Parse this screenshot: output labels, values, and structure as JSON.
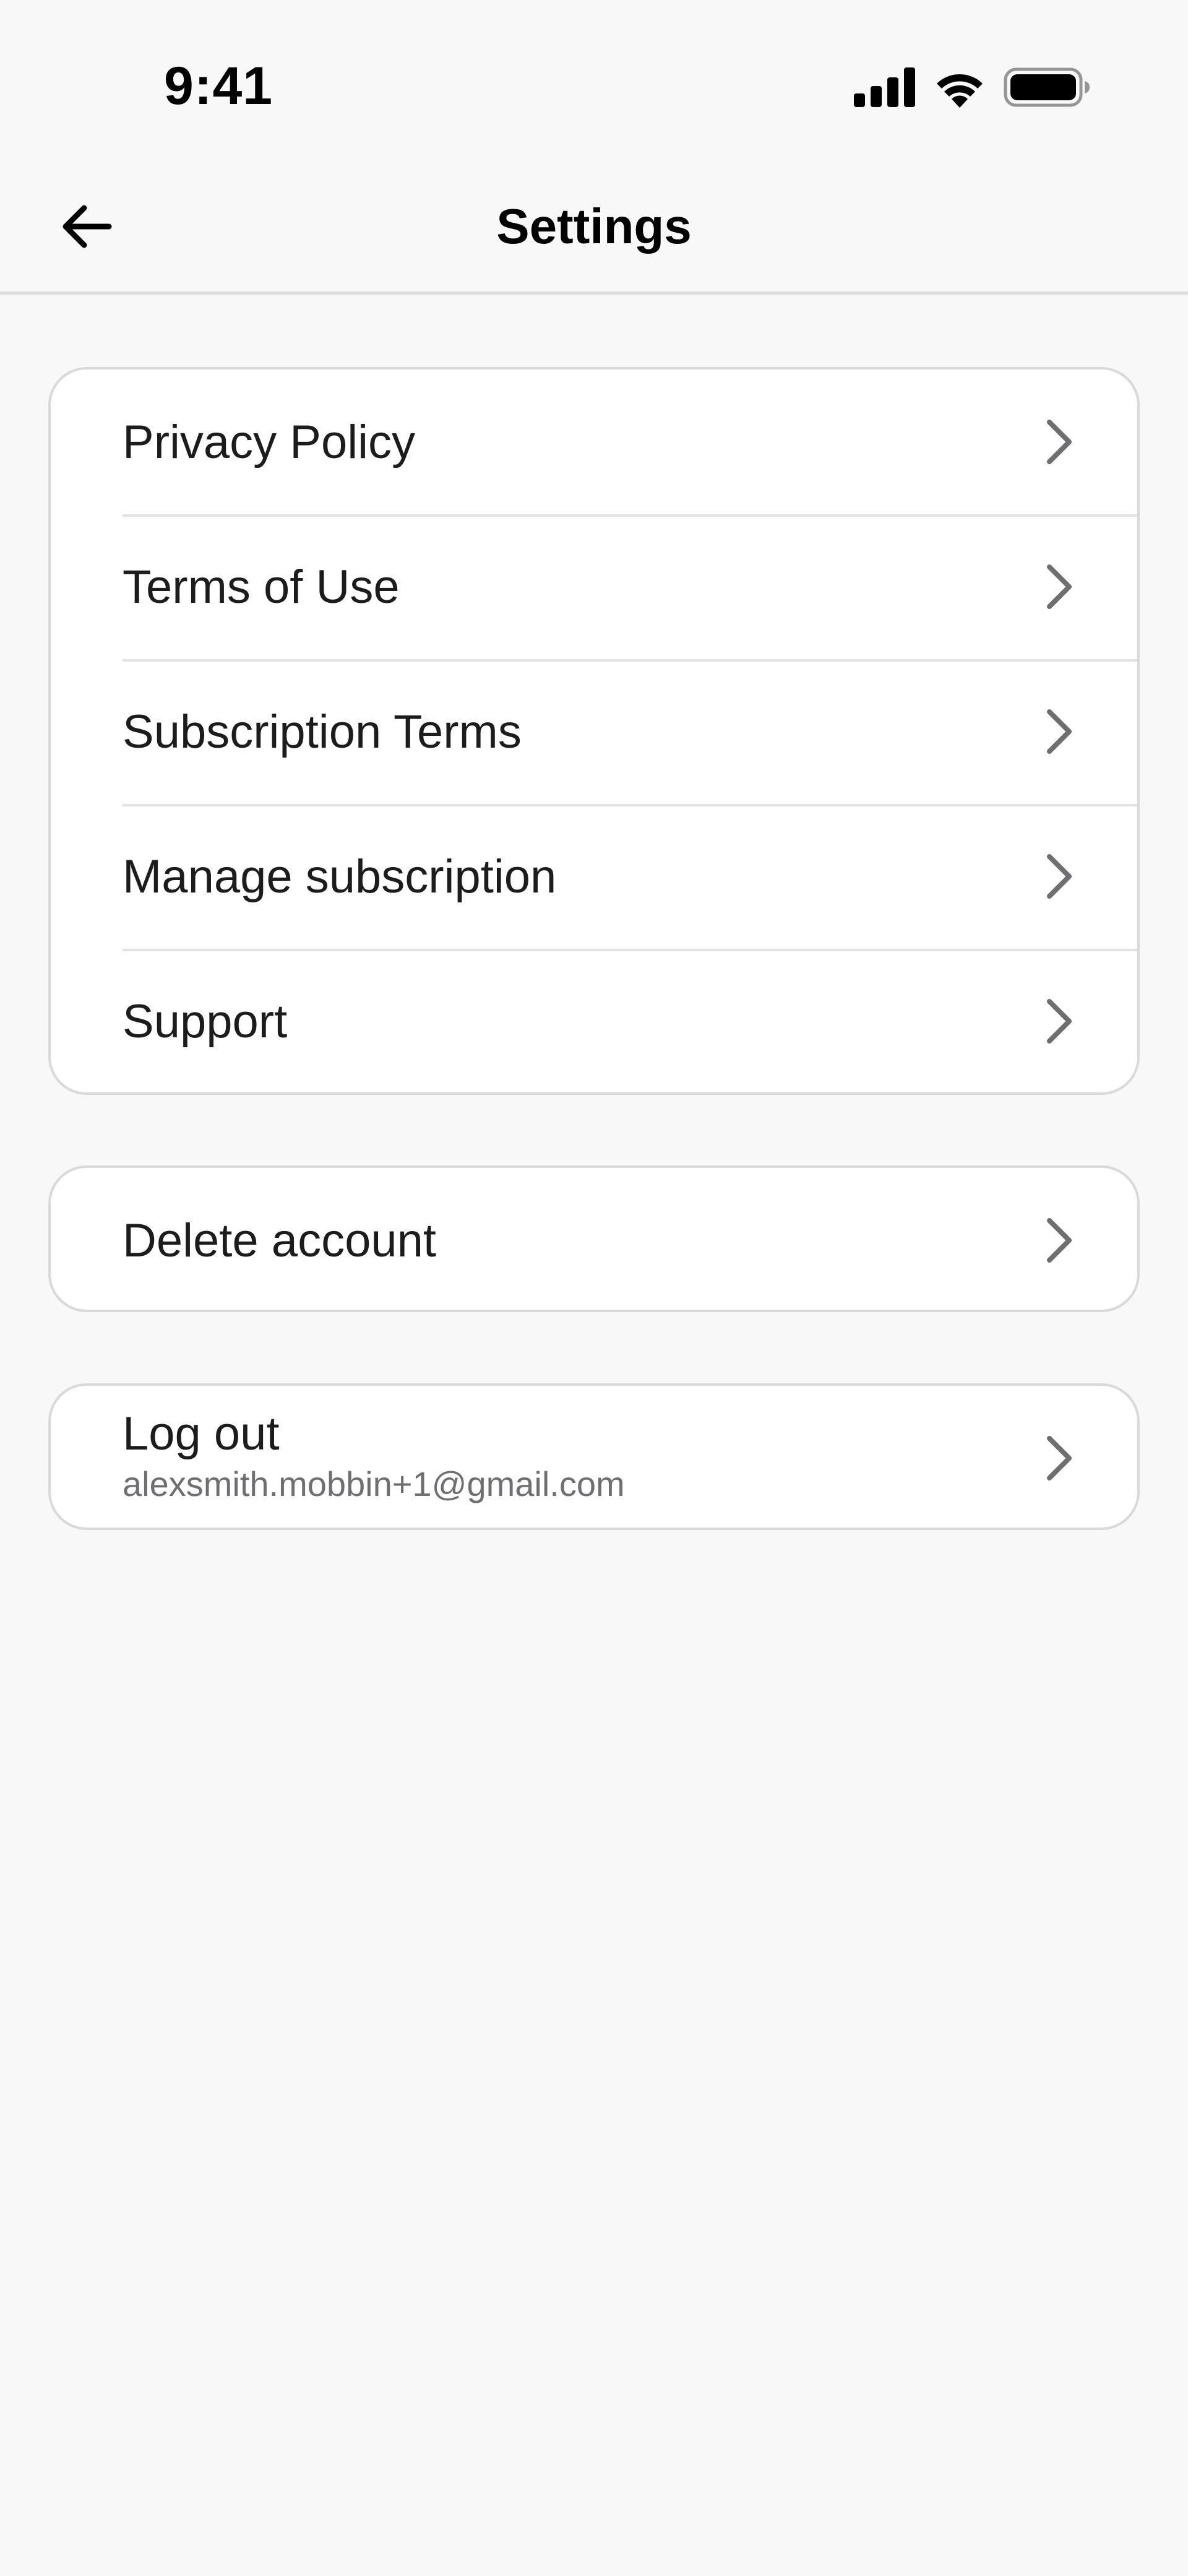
{
  "status_bar": {
    "time": "9:41",
    "icons": [
      "cellular-signal-icon",
      "wifi-icon",
      "battery-icon"
    ]
  },
  "nav": {
    "title": "Settings",
    "back_icon": "arrow-left-icon"
  },
  "links_section": {
    "items": [
      {
        "label": "Privacy Policy"
      },
      {
        "label": "Terms of Use"
      },
      {
        "label": "Subscription Terms"
      },
      {
        "label": "Manage subscription"
      },
      {
        "label": "Support"
      }
    ]
  },
  "account_section": {
    "delete_label": "Delete account"
  },
  "logout_section": {
    "label": "Log out",
    "email": "alexsmith.mobbin+1@gmail.com"
  },
  "colors": {
    "background": "#f8f8f8",
    "card": "#ffffff",
    "border": "#d9d9d9",
    "chevron": "#6e6e73",
    "text": "#1c1c1e",
    "secondary_text": "#6e6e73"
  }
}
